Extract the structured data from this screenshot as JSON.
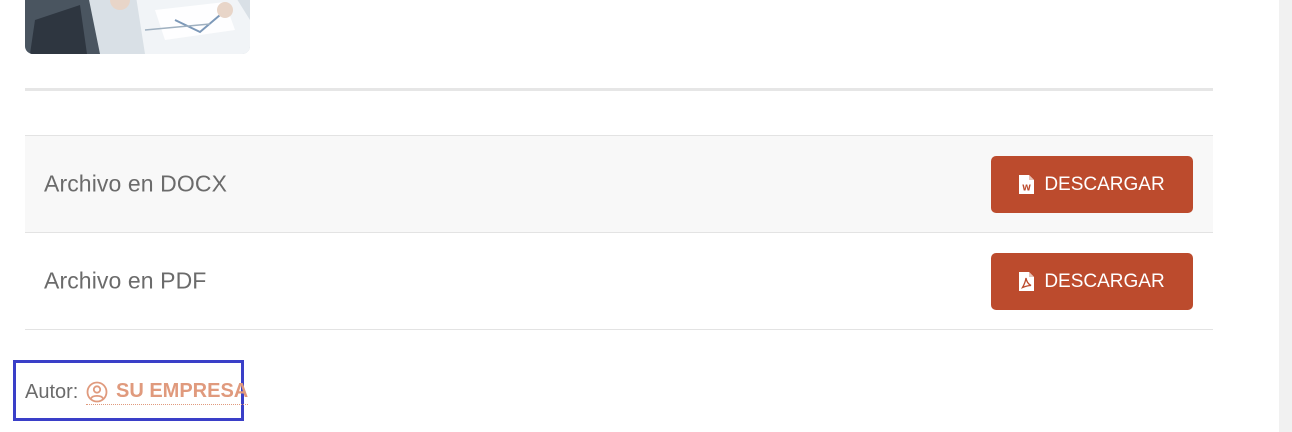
{
  "files": {
    "rows": [
      {
        "label": "Archivo en DOCX",
        "button_label": "DESCARGAR",
        "icon": "word-file-icon"
      },
      {
        "label": "Archivo en PDF",
        "button_label": "DESCARGAR",
        "icon": "pdf-file-icon"
      }
    ]
  },
  "author": {
    "label": "Autor:",
    "name": "SU EMPRESA",
    "icon": "user-circle-icon"
  },
  "colors": {
    "button_bg": "#bc4b2d",
    "author_link": "#e09a7d",
    "highlight_box": "#3a3fc8"
  }
}
